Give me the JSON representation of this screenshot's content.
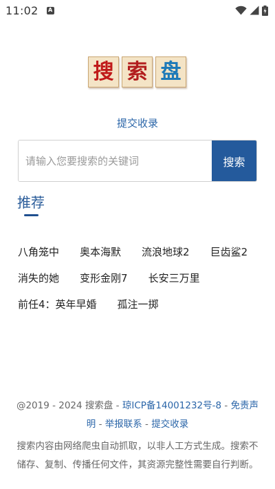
{
  "status_bar": {
    "time": "11:02",
    "notification_icon": "A"
  },
  "logo": {
    "chars": [
      "搜",
      "索",
      "盘"
    ],
    "colors": [
      "#c01a1a",
      "#b21e1e",
      "#1e7ab8"
    ]
  },
  "submit_link": "提交收录",
  "search": {
    "placeholder": "请输入您要搜索的关键词",
    "button_label": "搜索"
  },
  "recommend": {
    "title": "推荐",
    "rows": [
      [
        "八角笼中",
        "奥本海默",
        "流浪地球2",
        "巨齿鲨2"
      ],
      [
        "消失的她",
        "变形金刚7",
        "长安三万里"
      ],
      [
        "前任4：英年早婚",
        "孤注一掷"
      ]
    ]
  },
  "footer": {
    "copyright": "@2019 - 2024 搜索盘 - ",
    "icp": "琼ICP备14001232号-8",
    "sep": " - ",
    "disclaimer_link": "免责声明",
    "report_link": "举报联系",
    "submit_link": "提交收录",
    "disclaimer_text": "搜索内容由网络爬虫自动抓取，以非人工方式生成。搜索不储存、复制、传播任何文件，其资源完整性需要自行判断。"
  },
  "colors": {
    "accent": "#245a9c",
    "link": "#2a65a8"
  }
}
